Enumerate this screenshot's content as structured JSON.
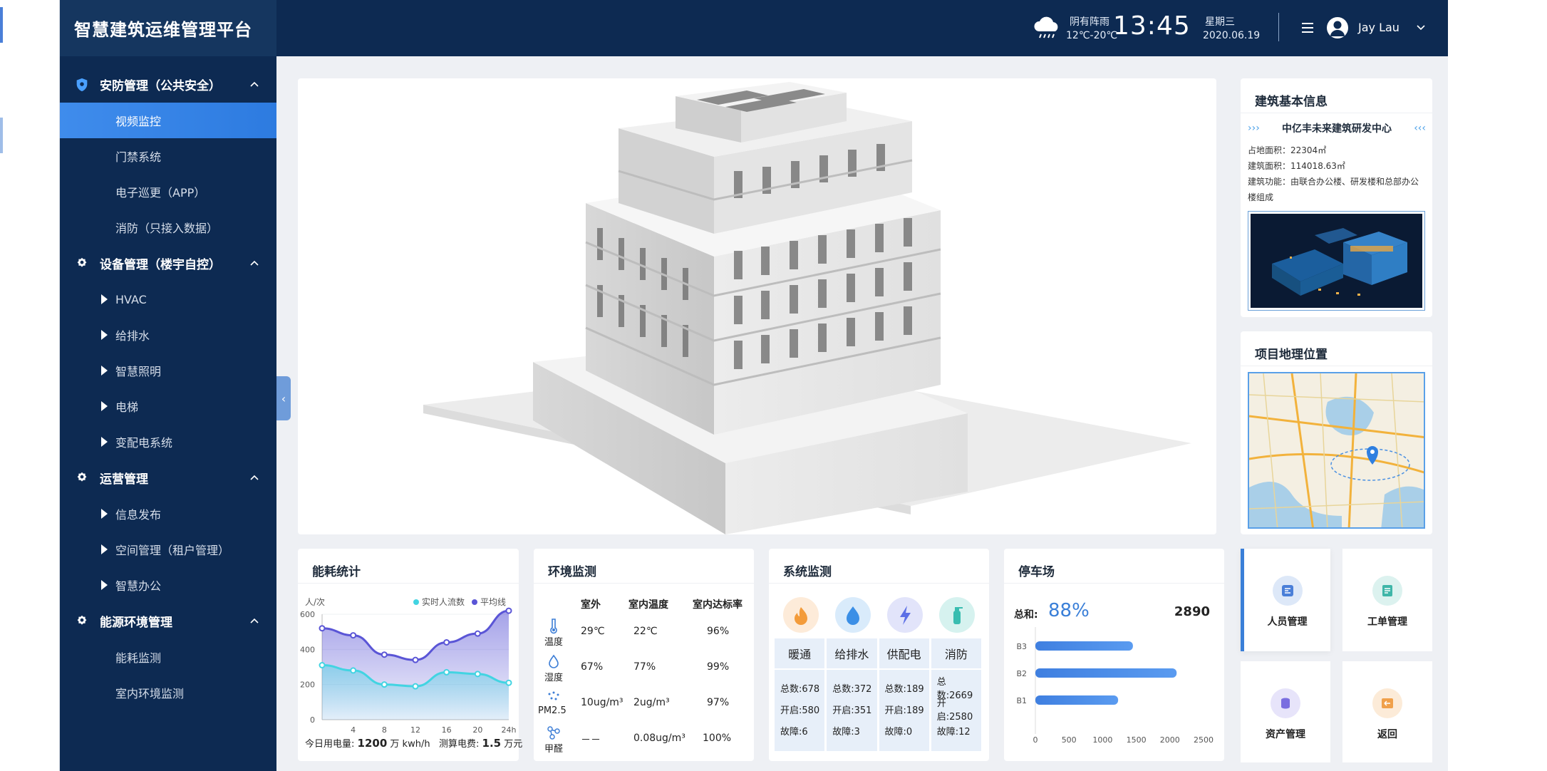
{
  "app": {
    "title": "智慧建筑运维管理平台"
  },
  "topbar": {
    "weather_desc": "阴有阵雨",
    "weather_temp": "12℃-20℃",
    "time": "13:45",
    "weekday": "星期三",
    "date": "2020.06.19",
    "user_name": "Jay Lau"
  },
  "sidebar": {
    "groups": [
      {
        "label": "安防管理（公共安全）",
        "icon": "shield-gear-icon"
      },
      {
        "label": "设备管理（楼宇自控）",
        "icon": "gear-icon"
      },
      {
        "label": "运营管理",
        "icon": "gear-icon"
      },
      {
        "label": "能源环境管理",
        "icon": "gear-icon"
      }
    ],
    "security_items": [
      "视频监控",
      "门禁系统",
      "电子巡更（APP）",
      "消防（只接入数据）"
    ],
    "device_items": [
      "HVAC",
      "给排水",
      "智慧照明",
      "电梯",
      "变配电系统"
    ],
    "ops_items": [
      "信息发布",
      "空间管理（租户管理）",
      "智慧办公"
    ],
    "energy_items": [
      "能耗监测",
      "室内环境监测"
    ],
    "active_item": "视频监控"
  },
  "building_info": {
    "title": "建筑基本信息",
    "name": "中亿丰未来建筑研发中心",
    "area_label": "占地面积：",
    "area_value": "22304㎡",
    "floor_label": "建筑面积：",
    "floor_value": "114018.63㎡",
    "function_label": "建筑功能：",
    "function_value_1": "由联合办公楼、研发楼和总部办公",
    "function_value_2": "楼组成"
  },
  "location": {
    "title": "项目地理位置"
  },
  "energy": {
    "title": "能耗统计",
    "unit": "人/次",
    "legend": [
      "实时人流数",
      "平均线"
    ],
    "today_label": "今日用电量:",
    "today_value": "1200",
    "today_unit": "万 kwh/h",
    "cost_label": "测算电费:",
    "cost_value": "1.5",
    "cost_unit": "万元"
  },
  "chart_data": {
    "type": "area",
    "x": [
      "0",
      "4",
      "8",
      "12",
      "16",
      "20",
      "24h"
    ],
    "xticks": [
      "4",
      "8",
      "12",
      "16",
      "20",
      "24h"
    ],
    "yticks": [
      "0",
      "200",
      "400",
      "600"
    ],
    "ylim": [
      0,
      600
    ],
    "series": [
      {
        "name": "平均线",
        "color": "#5a55d6",
        "points": [
          [
            0,
            520
          ],
          [
            4,
            480
          ],
          [
            8,
            370
          ],
          [
            12,
            340
          ],
          [
            16,
            440
          ],
          [
            20,
            490
          ],
          [
            24,
            620
          ]
        ]
      },
      {
        "name": "实时人流数",
        "color": "#42d4e2",
        "points": [
          [
            0,
            310
          ],
          [
            4,
            280
          ],
          [
            8,
            200
          ],
          [
            12,
            190
          ],
          [
            16,
            270
          ],
          [
            20,
            260
          ],
          [
            24,
            210
          ]
        ]
      }
    ]
  },
  "env": {
    "title": "环境监测",
    "headers": [
      "室外",
      "室内温度",
      "室内达标率"
    ],
    "rows": [
      {
        "label": "温度",
        "icon": "thermometer-icon",
        "outdoor": "29℃",
        "indoor": "22℃",
        "rate": "96%"
      },
      {
        "label": "湿度",
        "icon": "humidity-icon",
        "outdoor": "67%",
        "indoor": "77%",
        "rate": "99%"
      },
      {
        "label": "PM2.5",
        "icon": "pm25-icon",
        "outdoor": "10ug/m³",
        "indoor": "2ug/m³",
        "rate": "97%"
      },
      {
        "label": "甲醛",
        "icon": "molecule-icon",
        "outdoor": "－－",
        "indoor": "0.08ug/m³",
        "rate": "100%"
      }
    ]
  },
  "system": {
    "title": "系统监测",
    "columns": [
      {
        "name": "暖通",
        "icon": "fire-icon",
        "total": "总数:678",
        "on": "开启:580",
        "fault": "故障:6"
      },
      {
        "name": "给排水",
        "icon": "water-drop-icon",
        "total": "总数:372",
        "on": "开启:351",
        "fault": "故障:3"
      },
      {
        "name": "供配电",
        "icon": "lightning-icon",
        "total": "总数:189",
        "on": "开启:189",
        "fault": "故障:0"
      },
      {
        "name": "消防",
        "icon": "extinguisher-icon",
        "total": "总数:2669",
        "on": "开启:2580",
        "fault": "故障:12"
      }
    ]
  },
  "parking": {
    "title": "停车场",
    "total_label": "总和:",
    "percent": "88%",
    "count": "2890",
    "bars": [
      {
        "label": "B3",
        "value": 1450
      },
      {
        "label": "B2",
        "value": 2100
      },
      {
        "label": "B1",
        "value": 1230
      }
    ],
    "xticks": [
      "0",
      "500",
      "1000",
      "1500",
      "2000",
      "2500"
    ],
    "xmax": 2500
  },
  "quick": [
    {
      "label": "人员管理",
      "icon": "personnel-icon",
      "color": "#4a7fd8",
      "bg": "#dde8f8"
    },
    {
      "label": "工单管理",
      "icon": "workorder-icon",
      "color": "#3fb6a8",
      "bg": "#dcf2ef"
    },
    {
      "label": "资产管理",
      "icon": "asset-icon",
      "color": "#7a6ee0",
      "bg": "#e7e4fa"
    },
    {
      "label": "返回",
      "icon": "return-icon",
      "color": "#f0a04a",
      "bg": "#fcebd8"
    }
  ]
}
